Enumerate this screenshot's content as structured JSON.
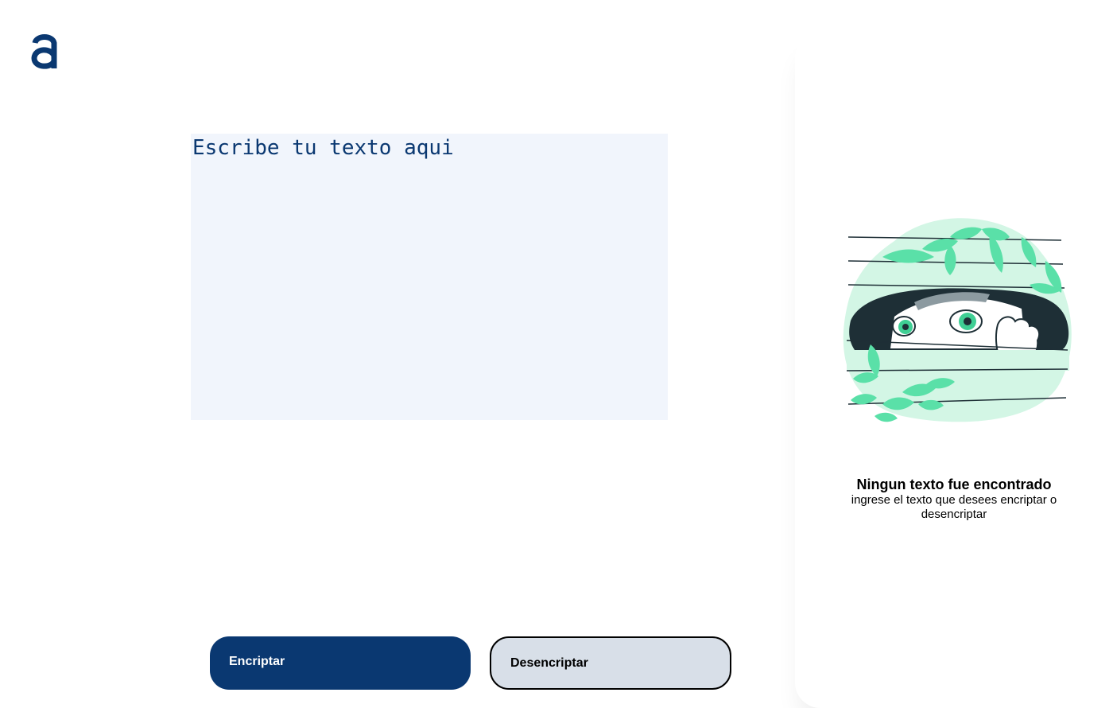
{
  "header": {
    "logo_icon": "letter-a-logo-icon",
    "brand_color": "#0a3871"
  },
  "editor": {
    "placeholder": "Escribe tu texto aqui",
    "value": ""
  },
  "actions": {
    "encrypt_label": "Encriptar",
    "decrypt_label": "Desencriptar"
  },
  "output": {
    "illustration_icon": "girl-peeking-through-blinds-illustration",
    "title": "Ningun texto fue encontrado",
    "message": "ingrese el texto que desees encriptar o desencriptar"
  },
  "colors": {
    "primary": "#0a3871",
    "input_background": "#f1f5fc",
    "secondary_button": "#d8dfe8",
    "illustration_accent": "#5ae0a8"
  }
}
